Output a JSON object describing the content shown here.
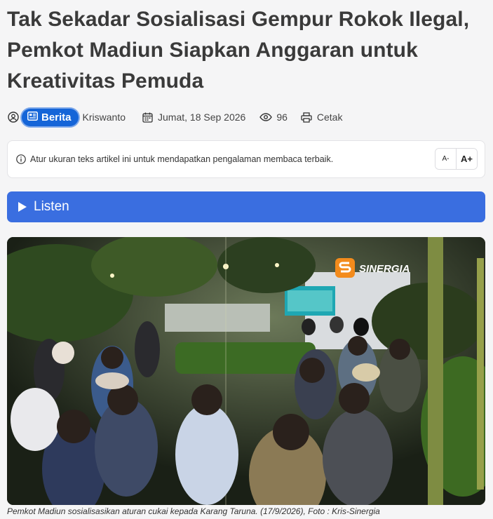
{
  "article": {
    "title": "Tak Sekadar Sosialisasi Gempur Rokok Ilegal, Pemkot Madiun Siapkan Anggaran untuk Kreativitas Pemuda",
    "category": "Berita",
    "author": "Kriswanto",
    "date": "Jumat, 18 Sep 2026",
    "views": "96",
    "print_label": "Cetak"
  },
  "text_size_notice": {
    "message": "Atur ukuran teks artikel ini untuk mendapatkan pengalaman membaca terbaik.",
    "decrease_label": "A-",
    "increase_label": "A+"
  },
  "listen_button": {
    "label": "Listen"
  },
  "photo": {
    "watermark": "SINERGIA",
    "caption": "Pemkot Madiun sosialisasikan aturan cukai kepada Karang Taruna. (17/9/2026), Foto : Kris-Sinergia"
  },
  "colors": {
    "accent": "#1565d8",
    "listen_bg": "#3a6ee0",
    "watermark": "#f38b1c"
  },
  "icons": [
    "user-icon",
    "news-icon",
    "calendar-icon",
    "eye-icon",
    "printer-icon",
    "info-icon",
    "play-icon",
    "sinergia-logo-icon"
  ]
}
